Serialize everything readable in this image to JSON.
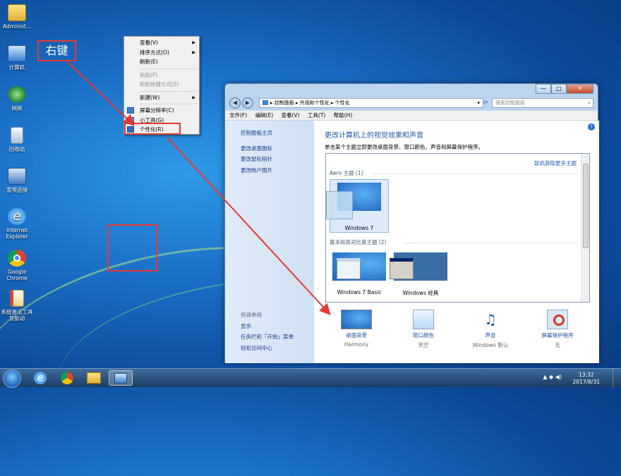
{
  "desktop": {
    "icons": [
      {
        "label": "Administ...",
        "icon": "folder-icon"
      },
      {
        "label": "计算机",
        "icon": "computer-icon"
      },
      {
        "label": "网络",
        "icon": "network-icon"
      },
      {
        "label": "回收站",
        "icon": "recycle-bin-icon"
      },
      {
        "label": "宽带连接",
        "icon": "broadband-icon"
      },
      {
        "label": "Internet Explorer",
        "icon": "ie-icon"
      },
      {
        "label": "Google Chrome",
        "icon": "chrome-icon"
      },
      {
        "label": "系统激活工具及驱动",
        "icon": "activation-tool-icon"
      }
    ]
  },
  "callout": "右键",
  "context_menu": {
    "view": "查看(V)",
    "sort": "排序方式(O)",
    "refresh": "刷新(E)",
    "paste": "粘贴(P)",
    "paste_shortcut": "粘贴快捷方式(S)",
    "new": "新建(W)",
    "resolution": "屏幕分辨率(C)",
    "gadgets": "小工具(G)",
    "personalize": "个性化(R)"
  },
  "window": {
    "address": {
      "root": "控制面板",
      "mid": "外观和个性化",
      "current": "个性化"
    },
    "search_placeholder": "搜索控制面板",
    "min_label": "—",
    "max_label": "□",
    "close_label": "✕",
    "menu": {
      "file": "文件(F)",
      "edit": "编辑(E)",
      "view": "查看(V)",
      "tools": "工具(T)",
      "help": "帮助(H)"
    },
    "sidebar": {
      "home": "控制面板主页",
      "desktop_icons": "更改桌面图标",
      "mouse_pointers": "更改鼠标指针",
      "account_picture": "更改帐户图片",
      "see_also": "另请参阅",
      "display": "显示",
      "taskbar": "任务栏和「开始」菜单",
      "ease_of_access": "轻松访问中心"
    },
    "main": {
      "title": "更改计算机上的视觉效果和声音",
      "description": "单击某个主题立即更改桌面背景、窗口颜色、声音和屏幕保护程序。",
      "online_link": "联机获取更多主题",
      "aero_group": "Aero 主题 (1)",
      "basic_group": "基本和高对比度主题 (2)",
      "themes": {
        "win7": "Windows 7",
        "basic": "Windows 7 Basic",
        "classic": "Windows 经典"
      }
    },
    "bottom": {
      "background": {
        "label": "桌面背景",
        "value": "Harmony"
      },
      "color": {
        "label": "窗口颜色",
        "value": "天空"
      },
      "sound": {
        "label": "声音",
        "value": "Windows 默认"
      },
      "screensaver": {
        "label": "屏幕保护程序",
        "value": "无"
      }
    }
  },
  "taskbar": {
    "time": "13:32",
    "date": "2017/8/31",
    "tray_glyph": "▲ ◆ ◀)"
  },
  "colors": {
    "highlight": "#e53935",
    "link": "#1a4fa2",
    "title": "#1e5aa8"
  }
}
